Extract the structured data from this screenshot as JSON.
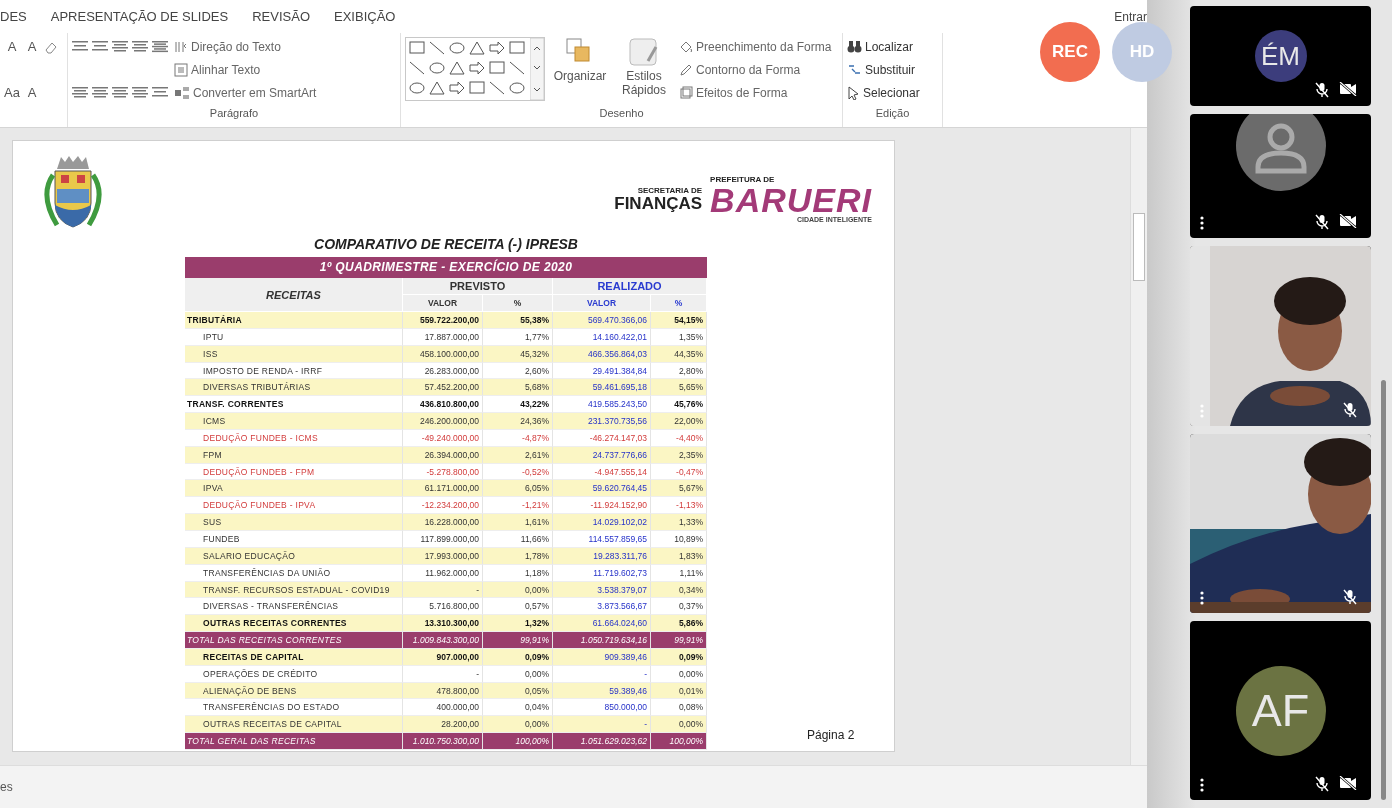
{
  "ribbon": {
    "tabs": [
      {
        "label": "DES"
      },
      {
        "label": "APRESENTAÇÃO DE SLIDES"
      },
      {
        "label": "REVISÃO"
      },
      {
        "label": "EXIBIÇÃO"
      }
    ],
    "sign_in": "Entrar",
    "font_tools": [
      "A",
      "A",
      "Aa",
      "A"
    ],
    "groups": [
      {
        "label": "Parágrafo",
        "commands": [
          "Direção do Texto",
          "Alinhar Texto",
          "Converter em SmartArt"
        ]
      },
      {
        "label": "Desenho",
        "buttons": [
          "Organizar",
          "Estilos Rápidos"
        ],
        "commands": [
          "Preenchimento da Forma",
          "Contorno da Forma",
          "Efeitos de Forma"
        ]
      },
      {
        "label": "Edição",
        "commands": [
          "Localizar",
          "Substituir",
          "Selecionar"
        ]
      }
    ]
  },
  "badges": [
    {
      "label": "REC",
      "color": "#f26d50"
    },
    {
      "label": "HD",
      "color": "#bfcbe2"
    }
  ],
  "slide": {
    "department_small": "SECRETARIA DE",
    "department": "FINANÇAS",
    "city_small": "PREFEITURA DE",
    "city": "BARUERI",
    "city_tagline": "CIDADE INTELIGENTE",
    "title": "COMPARATIVO DE RECEITA (-) IPRESB",
    "band": "1º QUADRIMESTRE - EXERCÍCIO DE 2020",
    "headers": {
      "receitas": "RECEITAS",
      "previsto": "PREVISTO",
      "realizado": "REALIZADO",
      "subheads": [
        "VALOR",
        "%",
        "VALOR",
        "%"
      ]
    },
    "rows": [
      {
        "kind": "group",
        "label": "TRIBUTÁRIA",
        "values": [
          "559.722.200,00",
          "55,38%",
          "569.470.366,06",
          "54,15%"
        ]
      },
      {
        "kind": "item",
        "label": "IPTU",
        "values": [
          "17.887.000,00",
          "1,77%",
          "14.160.422,01",
          "1,35%"
        ]
      },
      {
        "kind": "item",
        "label": "ISS",
        "values": [
          "458.100.000,00",
          "45,32%",
          "466.356.864,03",
          "44,35%"
        ]
      },
      {
        "kind": "item",
        "label": "IMPOSTO DE RENDA - IRRF",
        "values": [
          "26.283.000,00",
          "2,60%",
          "29.491.384,84",
          "2,80%"
        ]
      },
      {
        "kind": "item",
        "label": "DIVERSAS TRIBUTÁRIAS",
        "values": [
          "57.452.200,00",
          "5,68%",
          "59.461.695,18",
          "5,65%"
        ]
      },
      {
        "kind": "group",
        "label": "TRANSF. CORRENTES",
        "values": [
          "436.810.800,00",
          "43,22%",
          "419.585.243,50",
          "45,76%"
        ]
      },
      {
        "kind": "item",
        "label": "ICMS",
        "values": [
          "246.200.000,00",
          "24,36%",
          "231.370.735,56",
          "22,00%"
        ]
      },
      {
        "kind": "deduction",
        "label": "DEDUÇÃO FUNDEB - ICMS",
        "values": [
          "-49.240.000,00",
          "-4,87%",
          "-46.274.147,03",
          "-4,40%"
        ]
      },
      {
        "kind": "item",
        "label": "FPM",
        "values": [
          "26.394.000,00",
          "2,61%",
          "24.737.776,66",
          "2,35%"
        ]
      },
      {
        "kind": "deduction",
        "label": "DEDUÇÃO FUNDEB - FPM",
        "values": [
          "-5.278.800,00",
          "-0,52%",
          "-4.947.555,14",
          "-0,47%"
        ]
      },
      {
        "kind": "item",
        "label": "IPVA",
        "values": [
          "61.171.000,00",
          "6,05%",
          "59.620.764,45",
          "5,67%"
        ]
      },
      {
        "kind": "deduction",
        "label": "DEDUÇÃO FUNDEB - IPVA",
        "values": [
          "-12.234.200,00",
          "-1,21%",
          "-11.924.152,90",
          "-1,13%"
        ]
      },
      {
        "kind": "item",
        "label": "SUS",
        "values": [
          "16.228.000,00",
          "1,61%",
          "14.029.102,02",
          "1,33%"
        ]
      },
      {
        "kind": "item",
        "label": "FUNDEB",
        "values": [
          "117.899.000,00",
          "11,66%",
          "114.557.859,65",
          "10,89%"
        ]
      },
      {
        "kind": "item",
        "label": "SALARIO EDUCAÇÃO",
        "values": [
          "17.993.000,00",
          "1,78%",
          "19.283.311,76",
          "1,83%"
        ]
      },
      {
        "kind": "item",
        "label": "TRANSFERÊNCIAS DA UNIÃO",
        "values": [
          "11.962.000,00",
          "1,18%",
          "11.719.602,73",
          "1,11%"
        ]
      },
      {
        "kind": "item",
        "label": "TRANSF. RECURSOS ESTADUAL - COVID19",
        "values": [
          "-",
          "0,00%",
          "3.538.379,07",
          "0,34%"
        ]
      },
      {
        "kind": "item",
        "label": "DIVERSAS - TRANSFERÊNCIAS",
        "values": [
          "5.716.800,00",
          "0,57%",
          "3.873.566,67",
          "0,37%"
        ]
      },
      {
        "kind": "subgroup",
        "label": "OUTRAS RECEITAS CORRENTES",
        "values": [
          "13.310.300,00",
          "1,32%",
          "61.664.024,60",
          "5,86%"
        ]
      },
      {
        "kind": "total",
        "label": "TOTAL DAS RECEITAS CORRENTES",
        "values": [
          "1.009.843.300,00",
          "99,91%",
          "1.050.719.634,16",
          "99,91%"
        ]
      },
      {
        "kind": "subgroup",
        "label": "RECEITAS DE CAPITAL",
        "values": [
          "907.000,00",
          "0,09%",
          "909.389,46",
          "0,09%"
        ]
      },
      {
        "kind": "item",
        "label": "OPERAÇÕES DE CRÉDITO",
        "values": [
          "-",
          "0,00%",
          "-",
          "0,00%"
        ]
      },
      {
        "kind": "item",
        "label": "ALIENAÇÃO DE BENS",
        "values": [
          "478.800,00",
          "0,05%",
          "59.389,46",
          "0,01%"
        ]
      },
      {
        "kind": "item",
        "label": "TRANSFERÊNCIAS DO ESTADO",
        "values": [
          "400.000,00",
          "0,04%",
          "850.000,00",
          "0,08%"
        ]
      },
      {
        "kind": "item",
        "label": "OUTRAS RECEITAS DE CAPITAL",
        "values": [
          "28.200,00",
          "0,00%",
          "-",
          "0,00%"
        ]
      },
      {
        "kind": "total",
        "label": "TOTAL GERAL DAS RECEITAS",
        "values": [
          "1.010.750.300,00",
          "100,00%",
          "1.051.629.023,62",
          "100,00%"
        ]
      }
    ],
    "page_label": "Página 2"
  },
  "status_bar": {
    "text": "es"
  },
  "participants": [
    {
      "kind": "initials",
      "initials": "ÉM",
      "color": "#3c3d7c",
      "mic_muted": true,
      "camera_off": true,
      "menu": false
    },
    {
      "kind": "silhouette",
      "mic_muted": true,
      "camera_off": true,
      "menu": true
    },
    {
      "kind": "picture",
      "mic_muted": true,
      "camera_off": false,
      "menu": true
    },
    {
      "kind": "picture",
      "mic_muted": true,
      "camera_off": false,
      "menu": true
    },
    {
      "kind": "initials",
      "initials": "AF",
      "color": "#6b7342",
      "mic_muted": true,
      "camera_off": true,
      "menu": true
    }
  ]
}
